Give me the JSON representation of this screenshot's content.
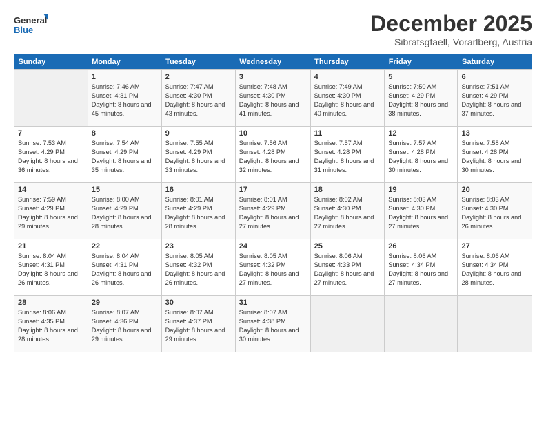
{
  "logo": {
    "line1": "General",
    "line2": "Blue"
  },
  "title": "December 2025",
  "subtitle": "Sibratsgfaell, Vorarlberg, Austria",
  "weekdays": [
    "Sunday",
    "Monday",
    "Tuesday",
    "Wednesday",
    "Thursday",
    "Friday",
    "Saturday"
  ],
  "weeks": [
    [
      {
        "day": "",
        "sunrise": "",
        "sunset": "",
        "daylight": ""
      },
      {
        "day": "1",
        "sunrise": "7:46 AM",
        "sunset": "4:31 PM",
        "daylight": "8 hours and 45 minutes."
      },
      {
        "day": "2",
        "sunrise": "7:47 AM",
        "sunset": "4:30 PM",
        "daylight": "8 hours and 43 minutes."
      },
      {
        "day": "3",
        "sunrise": "7:48 AM",
        "sunset": "4:30 PM",
        "daylight": "8 hours and 41 minutes."
      },
      {
        "day": "4",
        "sunrise": "7:49 AM",
        "sunset": "4:30 PM",
        "daylight": "8 hours and 40 minutes."
      },
      {
        "day": "5",
        "sunrise": "7:50 AM",
        "sunset": "4:29 PM",
        "daylight": "8 hours and 38 minutes."
      },
      {
        "day": "6",
        "sunrise": "7:51 AM",
        "sunset": "4:29 PM",
        "daylight": "8 hours and 37 minutes."
      }
    ],
    [
      {
        "day": "7",
        "sunrise": "7:53 AM",
        "sunset": "4:29 PM",
        "daylight": "8 hours and 36 minutes."
      },
      {
        "day": "8",
        "sunrise": "7:54 AM",
        "sunset": "4:29 PM",
        "daylight": "8 hours and 35 minutes."
      },
      {
        "day": "9",
        "sunrise": "7:55 AM",
        "sunset": "4:29 PM",
        "daylight": "8 hours and 33 minutes."
      },
      {
        "day": "10",
        "sunrise": "7:56 AM",
        "sunset": "4:28 PM",
        "daylight": "8 hours and 32 minutes."
      },
      {
        "day": "11",
        "sunrise": "7:57 AM",
        "sunset": "4:28 PM",
        "daylight": "8 hours and 31 minutes."
      },
      {
        "day": "12",
        "sunrise": "7:57 AM",
        "sunset": "4:28 PM",
        "daylight": "8 hours and 30 minutes."
      },
      {
        "day": "13",
        "sunrise": "7:58 AM",
        "sunset": "4:28 PM",
        "daylight": "8 hours and 30 minutes."
      }
    ],
    [
      {
        "day": "14",
        "sunrise": "7:59 AM",
        "sunset": "4:29 PM",
        "daylight": "8 hours and 29 minutes."
      },
      {
        "day": "15",
        "sunrise": "8:00 AM",
        "sunset": "4:29 PM",
        "daylight": "8 hours and 28 minutes."
      },
      {
        "day": "16",
        "sunrise": "8:01 AM",
        "sunset": "4:29 PM",
        "daylight": "8 hours and 28 minutes."
      },
      {
        "day": "17",
        "sunrise": "8:01 AM",
        "sunset": "4:29 PM",
        "daylight": "8 hours and 27 minutes."
      },
      {
        "day": "18",
        "sunrise": "8:02 AM",
        "sunset": "4:30 PM",
        "daylight": "8 hours and 27 minutes."
      },
      {
        "day": "19",
        "sunrise": "8:03 AM",
        "sunset": "4:30 PM",
        "daylight": "8 hours and 27 minutes."
      },
      {
        "day": "20",
        "sunrise": "8:03 AM",
        "sunset": "4:30 PM",
        "daylight": "8 hours and 26 minutes."
      }
    ],
    [
      {
        "day": "21",
        "sunrise": "8:04 AM",
        "sunset": "4:31 PM",
        "daylight": "8 hours and 26 minutes."
      },
      {
        "day": "22",
        "sunrise": "8:04 AM",
        "sunset": "4:31 PM",
        "daylight": "8 hours and 26 minutes."
      },
      {
        "day": "23",
        "sunrise": "8:05 AM",
        "sunset": "4:32 PM",
        "daylight": "8 hours and 26 minutes."
      },
      {
        "day": "24",
        "sunrise": "8:05 AM",
        "sunset": "4:32 PM",
        "daylight": "8 hours and 27 minutes."
      },
      {
        "day": "25",
        "sunrise": "8:06 AM",
        "sunset": "4:33 PM",
        "daylight": "8 hours and 27 minutes."
      },
      {
        "day": "26",
        "sunrise": "8:06 AM",
        "sunset": "4:34 PM",
        "daylight": "8 hours and 27 minutes."
      },
      {
        "day": "27",
        "sunrise": "8:06 AM",
        "sunset": "4:34 PM",
        "daylight": "8 hours and 28 minutes."
      }
    ],
    [
      {
        "day": "28",
        "sunrise": "8:06 AM",
        "sunset": "4:35 PM",
        "daylight": "8 hours and 28 minutes."
      },
      {
        "day": "29",
        "sunrise": "8:07 AM",
        "sunset": "4:36 PM",
        "daylight": "8 hours and 29 minutes."
      },
      {
        "day": "30",
        "sunrise": "8:07 AM",
        "sunset": "4:37 PM",
        "daylight": "8 hours and 29 minutes."
      },
      {
        "day": "31",
        "sunrise": "8:07 AM",
        "sunset": "4:38 PM",
        "daylight": "8 hours and 30 minutes."
      },
      {
        "day": "",
        "sunrise": "",
        "sunset": "",
        "daylight": ""
      },
      {
        "day": "",
        "sunrise": "",
        "sunset": "",
        "daylight": ""
      },
      {
        "day": "",
        "sunrise": "",
        "sunset": "",
        "daylight": ""
      }
    ]
  ]
}
